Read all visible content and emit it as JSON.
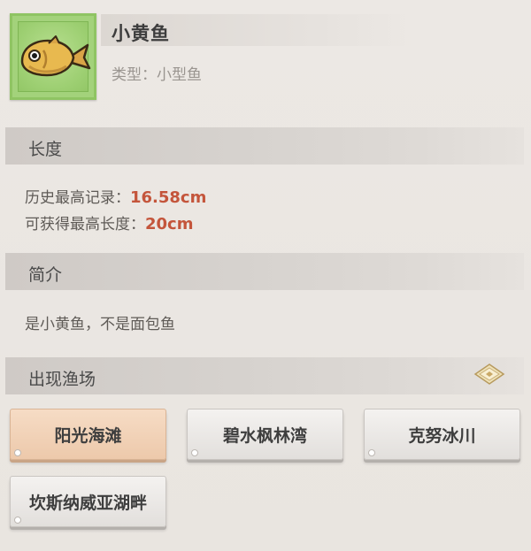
{
  "item": {
    "name": "小黄鱼",
    "type_label": "类型：小型鱼",
    "icon": "yellow-fish-icon"
  },
  "sections": {
    "length": {
      "title": "长度",
      "record_label": "历史最高记录：",
      "record_value": "16.58cm",
      "max_label": "可获得最高长度：",
      "max_value": "20cm"
    },
    "intro": {
      "title": "简介",
      "text": "是小黄鱼，不是面包鱼"
    },
    "locations": {
      "title": "出现渔场",
      "expand_icon": "diamond-expand-icon",
      "items": [
        {
          "label": "阳光海滩",
          "selected": true
        },
        {
          "label": "碧水枫林湾",
          "selected": false
        },
        {
          "label": "克努冰川",
          "selected": false
        },
        {
          "label": "坎斯纳威亚湖畔",
          "selected": false
        }
      ]
    }
  },
  "colors": {
    "value_highlight": "#c4553b",
    "icon_frame": "#a3d27b",
    "selected_button": "#f0cfb2"
  }
}
